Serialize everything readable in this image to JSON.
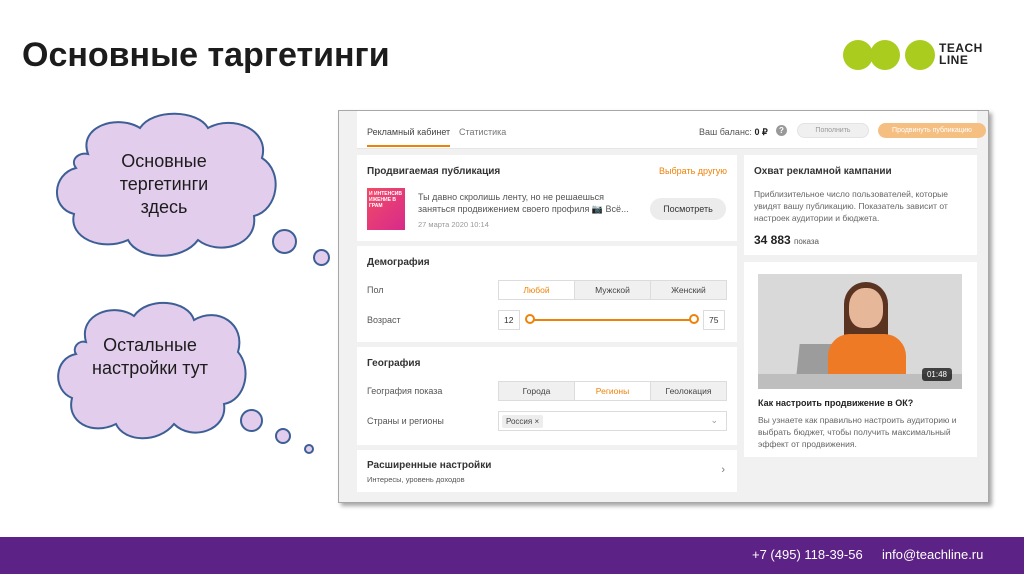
{
  "slide": {
    "title": "Основные таргетинги",
    "logo_text": [
      "TEACH",
      "LINE"
    ],
    "cloud_top": "Основные тергетинги здесь",
    "cloud_bottom": "Остальные настройки тут"
  },
  "footer": {
    "phone": "+7 (495) 118-39-56",
    "email": "info@teachline.ru",
    "bg_color": "#5c2285"
  },
  "app": {
    "accent_color": "#ee8208",
    "tabs": [
      {
        "label": "Рекламный кабинет",
        "active": true
      },
      {
        "label": "Статистика",
        "active": false
      }
    ],
    "balance_label": "Ваш баланс:",
    "balance_value": "0 ₽",
    "help_icon": "question-circle-icon",
    "topup_button": "Пополнить",
    "promote_button": "Продвинуть публикацию",
    "publication": {
      "title": "Продвигаемая публикация",
      "choose_link": "Выбрать другую",
      "thumb_text": "И ИНТЕНСИВ ИЖЕНИЕ В ГРАМ",
      "text": "Ты давно скролишь ленту, но не решаешься заняться продвижением своего профиля 📷 Всё...",
      "date": "27 марта 2020 10:14",
      "view_button": "Посмотреть"
    },
    "demography": {
      "title": "Демография",
      "gender_label": "Пол",
      "gender_options": [
        "Любой",
        "Мужской",
        "Женский"
      ],
      "gender_selected": "Любой",
      "age_label": "Возраст",
      "age_min": "12",
      "age_max": "75"
    },
    "geography": {
      "title": "География",
      "show_label": "География показа",
      "show_options": [
        "Города",
        "Регионы",
        "Геолокация"
      ],
      "show_selected": "Регионы",
      "countries_label": "Страны и регионы",
      "country_chip": "Россия ×"
    },
    "advanced": {
      "title": "Расширенные настройки",
      "subtitle": "Интересы, уровень доходов"
    },
    "reach": {
      "title": "Охват рекламной кампании",
      "description": "Приблизительное число пользователей, которые увидят вашу публикацию. Показатель зависит от настроек аудитории и бюджета.",
      "value": "34 883",
      "unit": "показа"
    },
    "video": {
      "duration": "01:48",
      "title": "Как настроить продвижение в ОК?",
      "description": "Вы узнаете как правильно настроить аудиторию и выбрать бюджет, чтобы получить максимальный эффект от продвижения."
    }
  }
}
